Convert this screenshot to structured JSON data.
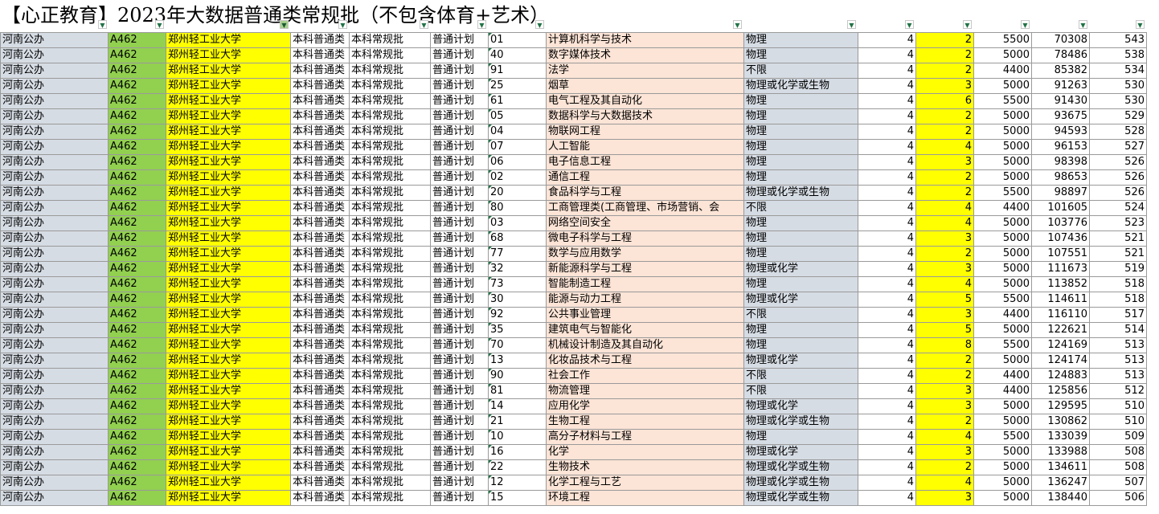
{
  "title": "【心正教育】2023年大数据普通类常规批（不包含体育+艺术）",
  "rows": [
    [
      "河南公办",
      "A462",
      "郑州轻工业大学",
      "本科普通类",
      "本科常规批",
      "普通计划",
      "01",
      "计算机科学与技术",
      "物理",
      "4",
      "2",
      "5500",
      "70308",
      "543"
    ],
    [
      "河南公办",
      "A462",
      "郑州轻工业大学",
      "本科普通类",
      "本科常规批",
      "普通计划",
      "40",
      "数字媒体技术",
      "物理",
      "4",
      "2",
      "5000",
      "78486",
      "538"
    ],
    [
      "河南公办",
      "A462",
      "郑州轻工业大学",
      "本科普通类",
      "本科常规批",
      "普通计划",
      "91",
      "法学",
      "不限",
      "4",
      "2",
      "4400",
      "85382",
      "534"
    ],
    [
      "河南公办",
      "A462",
      "郑州轻工业大学",
      "本科普通类",
      "本科常规批",
      "普通计划",
      "25",
      "烟草",
      "物理或化学或生物",
      "4",
      "3",
      "5000",
      "91263",
      "530"
    ],
    [
      "河南公办",
      "A462",
      "郑州轻工业大学",
      "本科普通类",
      "本科常规批",
      "普通计划",
      "61",
      "电气工程及其自动化",
      "物理",
      "4",
      "6",
      "5500",
      "91430",
      "530"
    ],
    [
      "河南公办",
      "A462",
      "郑州轻工业大学",
      "本科普通类",
      "本科常规批",
      "普通计划",
      "05",
      "数据科学与大数据技术",
      "物理",
      "4",
      "2",
      "5000",
      "93675",
      "529"
    ],
    [
      "河南公办",
      "A462",
      "郑州轻工业大学",
      "本科普通类",
      "本科常规批",
      "普通计划",
      "04",
      "物联网工程",
      "物理",
      "4",
      "2",
      "5000",
      "94593",
      "528"
    ],
    [
      "河南公办",
      "A462",
      "郑州轻工业大学",
      "本科普通类",
      "本科常规批",
      "普通计划",
      "07",
      "人工智能",
      "物理",
      "4",
      "4",
      "5000",
      "96153",
      "527"
    ],
    [
      "河南公办",
      "A462",
      "郑州轻工业大学",
      "本科普通类",
      "本科常规批",
      "普通计划",
      "06",
      "电子信息工程",
      "物理",
      "4",
      "3",
      "5000",
      "98398",
      "526"
    ],
    [
      "河南公办",
      "A462",
      "郑州轻工业大学",
      "本科普通类",
      "本科常规批",
      "普通计划",
      "02",
      "通信工程",
      "物理",
      "4",
      "2",
      "5000",
      "98653",
      "526"
    ],
    [
      "河南公办",
      "A462",
      "郑州轻工业大学",
      "本科普通类",
      "本科常规批",
      "普通计划",
      "20",
      "食品科学与工程",
      "物理或化学或生物",
      "4",
      "2",
      "5500",
      "98897",
      "526"
    ],
    [
      "河南公办",
      "A462",
      "郑州轻工业大学",
      "本科普通类",
      "本科常规批",
      "普通计划",
      "80",
      "工商管理类(工商管理、市场营销、会",
      "不限",
      "4",
      "4",
      "4400",
      "101605",
      "524"
    ],
    [
      "河南公办",
      "A462",
      "郑州轻工业大学",
      "本科普通类",
      "本科常规批",
      "普通计划",
      "03",
      "网络空间安全",
      "物理",
      "4",
      "4",
      "5000",
      "103776",
      "523"
    ],
    [
      "河南公办",
      "A462",
      "郑州轻工业大学",
      "本科普通类",
      "本科常规批",
      "普通计划",
      "68",
      "微电子科学与工程",
      "物理",
      "4",
      "3",
      "5000",
      "107436",
      "521"
    ],
    [
      "河南公办",
      "A462",
      "郑州轻工业大学",
      "本科普通类",
      "本科常规批",
      "普通计划",
      "77",
      "数学与应用数学",
      "物理",
      "4",
      "2",
      "5000",
      "107551",
      "521"
    ],
    [
      "河南公办",
      "A462",
      "郑州轻工业大学",
      "本科普通类",
      "本科常规批",
      "普通计划",
      "32",
      "新能源科学与工程",
      "物理或化学",
      "4",
      "3",
      "5000",
      "111673",
      "519"
    ],
    [
      "河南公办",
      "A462",
      "郑州轻工业大学",
      "本科普通类",
      "本科常规批",
      "普通计划",
      "73",
      "智能制造工程",
      "物理",
      "4",
      "4",
      "5000",
      "113852",
      "518"
    ],
    [
      "河南公办",
      "A462",
      "郑州轻工业大学",
      "本科普通类",
      "本科常规批",
      "普通计划",
      "30",
      "能源与动力工程",
      "物理或化学",
      "4",
      "5",
      "5500",
      "114611",
      "518"
    ],
    [
      "河南公办",
      "A462",
      "郑州轻工业大学",
      "本科普通类",
      "本科常规批",
      "普通计划",
      "92",
      "公共事业管理",
      "不限",
      "4",
      "3",
      "4400",
      "116110",
      "517"
    ],
    [
      "河南公办",
      "A462",
      "郑州轻工业大学",
      "本科普通类",
      "本科常规批",
      "普通计划",
      "35",
      "建筑电气与智能化",
      "物理",
      "4",
      "5",
      "5000",
      "122621",
      "514"
    ],
    [
      "河南公办",
      "A462",
      "郑州轻工业大学",
      "本科普通类",
      "本科常规批",
      "普通计划",
      "70",
      "机械设计制造及其自动化",
      "物理",
      "4",
      "8",
      "5500",
      "124169",
      "513"
    ],
    [
      "河南公办",
      "A462",
      "郑州轻工业大学",
      "本科普通类",
      "本科常规批",
      "普通计划",
      "13",
      "化妆品技术与工程",
      "物理或化学",
      "4",
      "2",
      "5000",
      "124174",
      "513"
    ],
    [
      "河南公办",
      "A462",
      "郑州轻工业大学",
      "本科普通类",
      "本科常规批",
      "普通计划",
      "90",
      "社会工作",
      "不限",
      "4",
      "2",
      "4400",
      "124883",
      "513"
    ],
    [
      "河南公办",
      "A462",
      "郑州轻工业大学",
      "本科普通类",
      "本科常规批",
      "普通计划",
      "81",
      "物流管理",
      "不限",
      "4",
      "3",
      "4400",
      "125856",
      "512"
    ],
    [
      "河南公办",
      "A462",
      "郑州轻工业大学",
      "本科普通类",
      "本科常规批",
      "普通计划",
      "14",
      "应用化学",
      "物理或化学",
      "4",
      "3",
      "5000",
      "129595",
      "510"
    ],
    [
      "河南公办",
      "A462",
      "郑州轻工业大学",
      "本科普通类",
      "本科常规批",
      "普通计划",
      "21",
      "生物工程",
      "物理或化学或生物",
      "4",
      "2",
      "5000",
      "130862",
      "510"
    ],
    [
      "河南公办",
      "A462",
      "郑州轻工业大学",
      "本科普通类",
      "本科常规批",
      "普通计划",
      "10",
      "高分子材料与工程",
      "物理",
      "4",
      "4",
      "5500",
      "133039",
      "509"
    ],
    [
      "河南公办",
      "A462",
      "郑州轻工业大学",
      "本科普通类",
      "本科常规批",
      "普通计划",
      "16",
      "化学",
      "物理或化学",
      "4",
      "3",
      "5000",
      "133988",
      "508"
    ],
    [
      "河南公办",
      "A462",
      "郑州轻工业大学",
      "本科普通类",
      "本科常规批",
      "普通计划",
      "22",
      "生物技术",
      "物理或化学或生物",
      "4",
      "2",
      "5000",
      "134611",
      "508"
    ],
    [
      "河南公办",
      "A462",
      "郑州轻工业大学",
      "本科普通类",
      "本科常规批",
      "普通计划",
      "12",
      "化学工程与工艺",
      "物理或化学或生物",
      "4",
      "4",
      "5000",
      "136247",
      "507"
    ],
    [
      "河南公办",
      "A462",
      "郑州轻工业大学",
      "本科普通类",
      "本科常规批",
      "普通计划",
      "15",
      "环境工程",
      "物理或化学或生物",
      "4",
      "3",
      "5000",
      "138440",
      "506"
    ]
  ],
  "filter_icon": "dropdown-arrow-icon",
  "filter_active_icon": "filter-applied-icon",
  "colors": {
    "province_bg": "#d6dce4",
    "code_bg": "#92d050",
    "university_bg": "#ffff00",
    "major_bg": "#fce4d6",
    "subject_bg": "#d6dce4",
    "plan_count_bg": "#ffff00"
  }
}
